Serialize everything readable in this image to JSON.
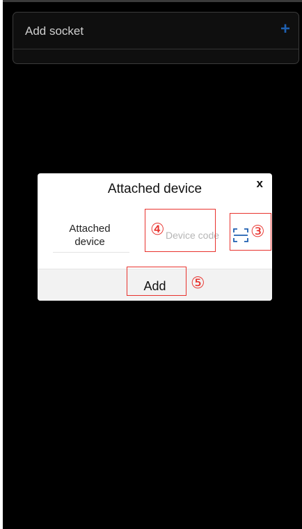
{
  "header": {
    "title": "Add socket",
    "add_icon_glyph": "+"
  },
  "dialog": {
    "title": "Attached device",
    "close_label": "x",
    "field_label_line1": "Attached",
    "field_label_line2": "device",
    "device_code_placeholder": "Device code",
    "device_code_value": "",
    "scan_icon": "scan-qr-icon",
    "add_button_label": "Add"
  },
  "annotations": {
    "marker_3": "③",
    "marker_4": "④",
    "marker_5": "⑤"
  },
  "colors": {
    "background": "#000000",
    "accent": "#1e5fb0",
    "annotation": "#e8322d",
    "dialog_bg": "#ffffff"
  }
}
